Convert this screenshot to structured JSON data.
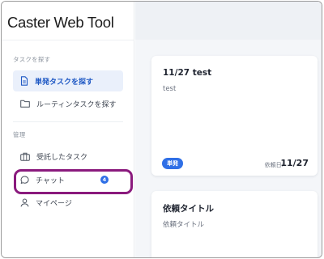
{
  "app": {
    "title": "Caster Web Tool"
  },
  "sidebar": {
    "task_section_label": "タスクを探す",
    "task_items": [
      {
        "label": "単発タスクを探す",
        "active": true,
        "icon": "document-icon"
      },
      {
        "label": "ルーティンタスクを探す",
        "active": false,
        "icon": "folder-icon"
      }
    ],
    "manage_section_label": "管理",
    "manage_items": [
      {
        "label": "受託したタスク",
        "icon": "briefcase-icon"
      },
      {
        "label": "チャット",
        "icon": "chat-icon",
        "badge": "4"
      },
      {
        "label": "マイページ",
        "icon": "user-icon"
      }
    ]
  },
  "tasks": [
    {
      "title": "11/27 test",
      "description": "test",
      "tag": "単発",
      "date_label": "依頼日:",
      "date": "11/27"
    },
    {
      "title": "依頼タイトル",
      "description": "依頼タイトル"
    }
  ],
  "colors": {
    "accent": "#2f6fe6",
    "highlight": "#8a1a7d",
    "active_bg": "#eaf0fb"
  }
}
